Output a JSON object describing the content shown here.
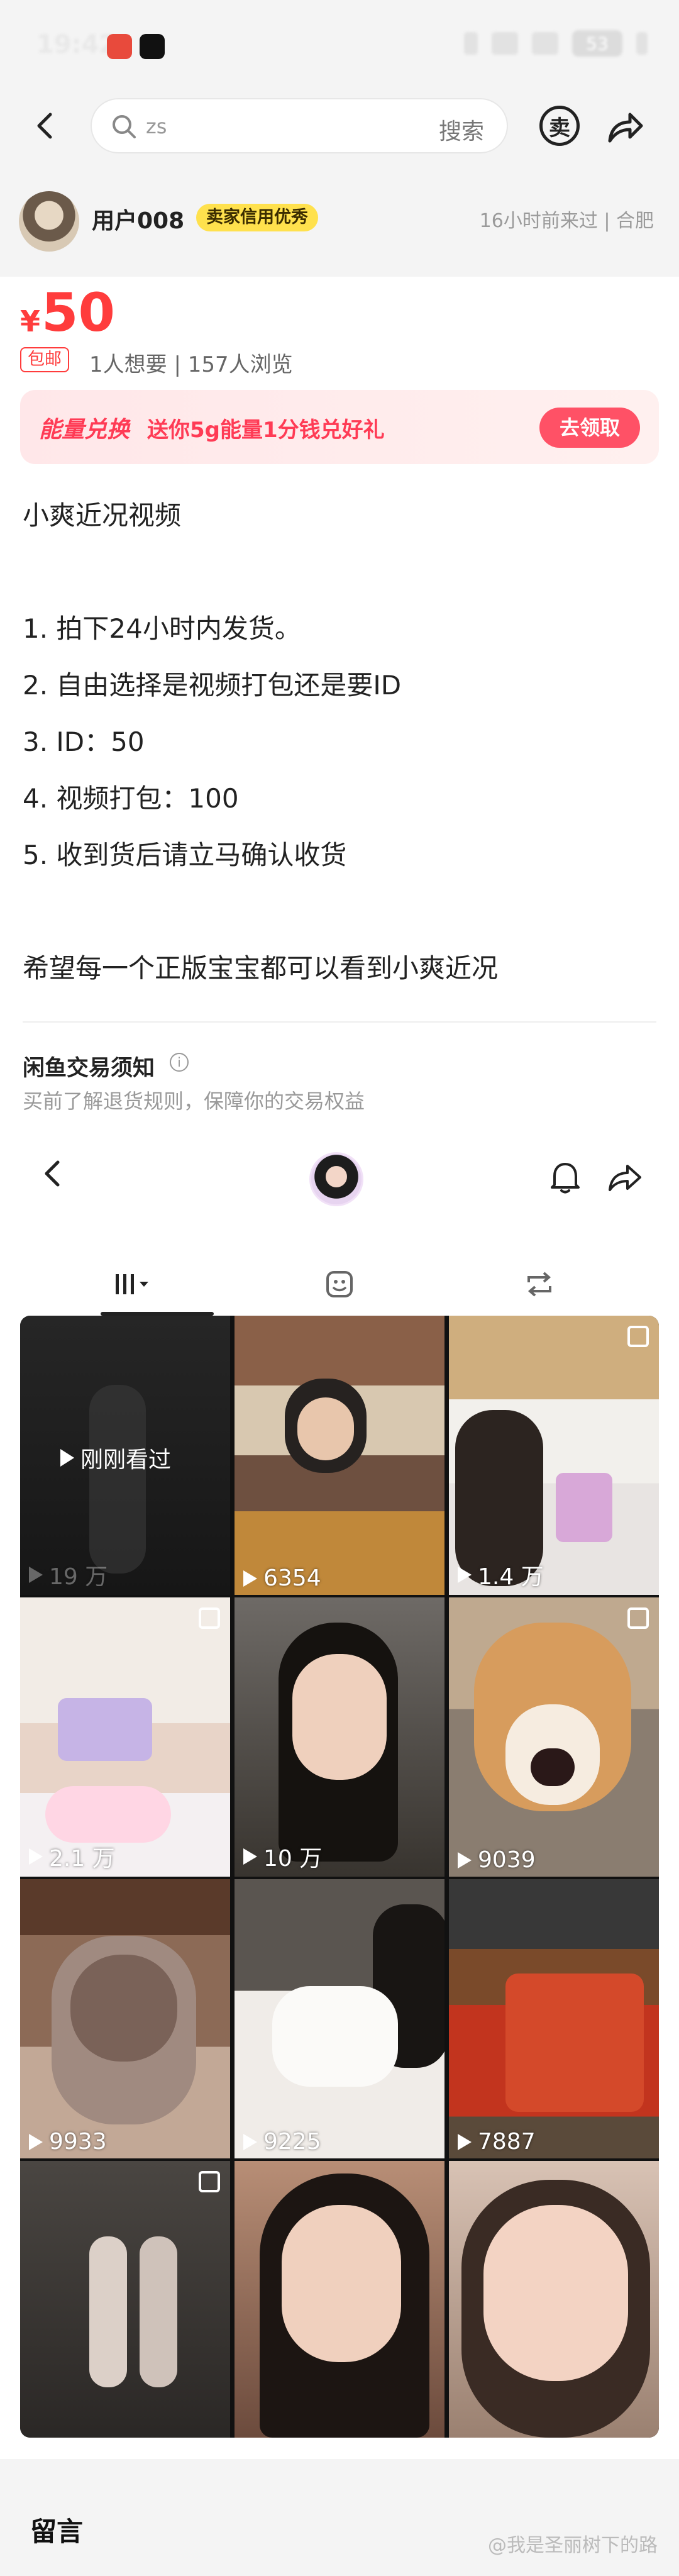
{
  "status_bar": {
    "time": "19:42",
    "battery": "53"
  },
  "search": {
    "placeholder": "zs",
    "action": "搜索"
  },
  "header": {
    "sell_icon_label": "卖"
  },
  "seller": {
    "name": "用户008",
    "badge": "卖家信用优秀",
    "last_seen": "16小时前来过 | 合肥"
  },
  "listing": {
    "currency": "¥",
    "price": "50",
    "shipping_badge": "包邮",
    "stats": "1人想要 | 157人浏览"
  },
  "promo": {
    "title": "能量兑换",
    "text": "送你5g能量1分钱兑好礼",
    "button": "去领取"
  },
  "description": {
    "lines": [
      "小爽近况视频",
      "1. 拍下24小时内发货。",
      "2. 自由选择是视频打包还是要ID",
      "3. ID：50",
      "4. 视频打包：100",
      "5. 收到货后请立马确认收货",
      "希望每一个正版宝宝都可以看到小爽近况"
    ]
  },
  "notice": {
    "title": "闲鱼交易须知",
    "subtitle": "买前了解退货规则，保障你的交易权益"
  },
  "embedded_profile": {
    "tabs": [
      "works-grid-icon",
      "sticker-icon",
      "repost-icon"
    ],
    "videos": [
      {
        "count": "19 万",
        "overlay": "刚刚看过"
      },
      {
        "count": "6354"
      },
      {
        "count": "1.4 万"
      },
      {
        "count": "2.1 万"
      },
      {
        "count": "10 万"
      },
      {
        "count": "9039"
      },
      {
        "count": "9933"
      },
      {
        "count": "9225"
      },
      {
        "count": "7887"
      },
      {
        "count": ""
      },
      {
        "count": ""
      },
      {
        "count": ""
      }
    ]
  },
  "footer": {
    "section_title": "留言",
    "watermark": "@我是圣丽树下的路"
  },
  "colors": {
    "accent_red": "#ff3c3c",
    "badge_yellow": "#ffe14d",
    "promo_pink": "#ff3b55"
  }
}
